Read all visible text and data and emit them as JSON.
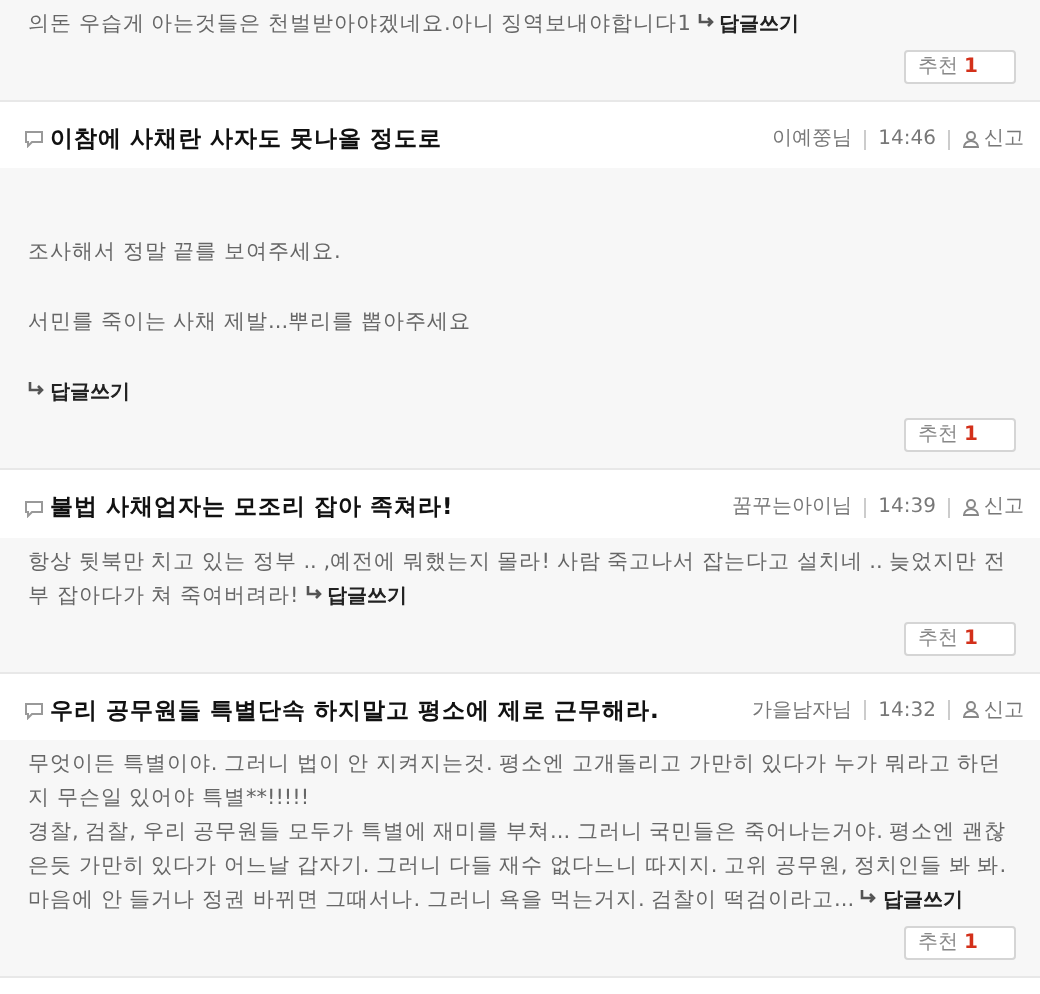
{
  "comments": [
    {
      "body": {
        "kind": "compact",
        "paragraphs": [
          "의돈 우습게 아는것들은 천벌받아야겠네요.아니 징역보내야합니다1"
        ]
      },
      "reply_label": "답글쓰기",
      "reply_own_line": false,
      "recommend": {
        "label": "추천",
        "count": "1"
      }
    },
    {
      "title": "이참에 사채란 사자도 못나올 정도로",
      "author": "이예쭝님",
      "time": "14:46",
      "report": "신고",
      "body": {
        "kind": "spaced",
        "paragraphs": [
          "조사해서 정말 끝를 보여주세요.",
          "서민를 죽이는 사채 제발...뿌리를 뽑아주세요"
        ]
      },
      "reply_label": "답글쓰기",
      "reply_own_line": true,
      "recommend": {
        "label": "추천",
        "count": "1"
      }
    },
    {
      "title": "불법 사채업자는 모조리 잡아 족쳐라!",
      "author": "꿈꾸는아이님",
      "time": "14:39",
      "report": "신고",
      "body": {
        "kind": "compact",
        "paragraphs": [
          "항상 뒷북만 치고 있는 정부 .. ,예전에 뭐했는지 몰라! 사람 죽고나서 잡는다고 설치네 .. 늦었지만 전부 잡아다가 쳐 죽여버려라!"
        ]
      },
      "reply_label": "답글쓰기",
      "reply_own_line": false,
      "recommend": {
        "label": "추천",
        "count": "1"
      }
    },
    {
      "title": "우리 공무원들 특별단속 하지말고 평소에 제로 근무해라.",
      "author": "가을남자님",
      "time": "14:32",
      "report": "신고",
      "body": {
        "kind": "compact",
        "paragraphs": [
          "무엇이든 특별이야. 그러니 법이 안 지켜지는것. 평소엔 고개돌리고 가만히 있다가 누가 뭐라고 하던지 무슨일 있어야 특별**!!!!!",
          "경찰, 검찰, 우리 공무원들 모두가 특별에 재미를 부쳐... 그러니 국민들은 죽어나는거야. 평소엔 괜찮은듯 가만히 있다가 어느날 갑자기. 그러니 다들 재수 없다느니 따지지. 고위 공무원, 정치인들 봐 봐. 마음에 안 들거나 정권 바뀌면 그때서나. 그러니 욕을 먹는거지. 검찰이 떡검이라고..."
        ]
      },
      "reply_label": "답글쓰기",
      "reply_own_line": false,
      "recommend": {
        "label": "추천",
        "count": "1"
      }
    }
  ]
}
